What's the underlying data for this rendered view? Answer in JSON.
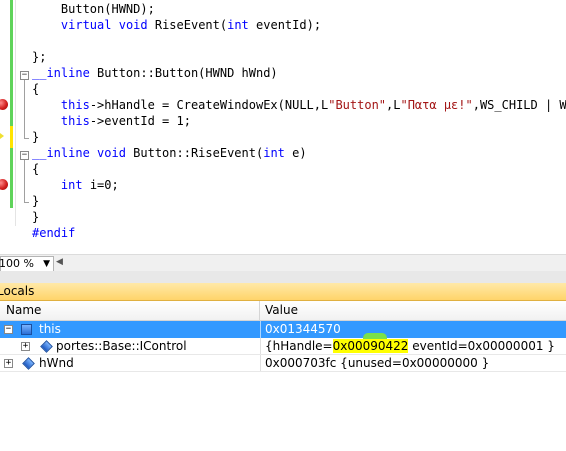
{
  "editor": {
    "lines": [
      "    Button(HWND);",
      "    virtual void RiseEvent(int eventId);",
      "",
      "};",
      "__inline Button::Button(HWND hWnd)",
      "{",
      "    this->hHandle = CreateWindowEx(NULL,L\"Button\",L\"Πατα με!\",WS_CHILD | WS_V",
      "    this->eventId = 1;",
      "}",
      "__inline void Button::RiseEvent(int e)",
      "{",
      "    int i=0;",
      "}",
      "}",
      "#endif"
    ]
  },
  "zoom": {
    "value": "100 %"
  },
  "locals": {
    "title": "Locals",
    "columns": {
      "name": "Name",
      "value": "Value"
    },
    "rows": [
      {
        "name": "this",
        "value": "0x01344570",
        "expander": "minus"
      },
      {
        "name": "portes::Base::IControl",
        "value_prefix": "{hHandle=",
        "value_highlight": "0x00090422",
        "value_suffix": " eventId=0x00000001 }",
        "expander": "plus"
      },
      {
        "name": "hWnd",
        "value": "0x000703fc {unused=0x00000000 }",
        "expander": "plus"
      }
    ]
  },
  "colors": {
    "selection": "#3399ff",
    "panel_header": "#ffd46a",
    "keyword": "#0000ff",
    "string": "#a31515",
    "breakpoint": "#d32020"
  },
  "icons": [
    "breakpoint-icon",
    "current-statement-arrow-icon",
    "collapse-icon",
    "expand-icon",
    "struct-icon",
    "field-icon"
  ]
}
